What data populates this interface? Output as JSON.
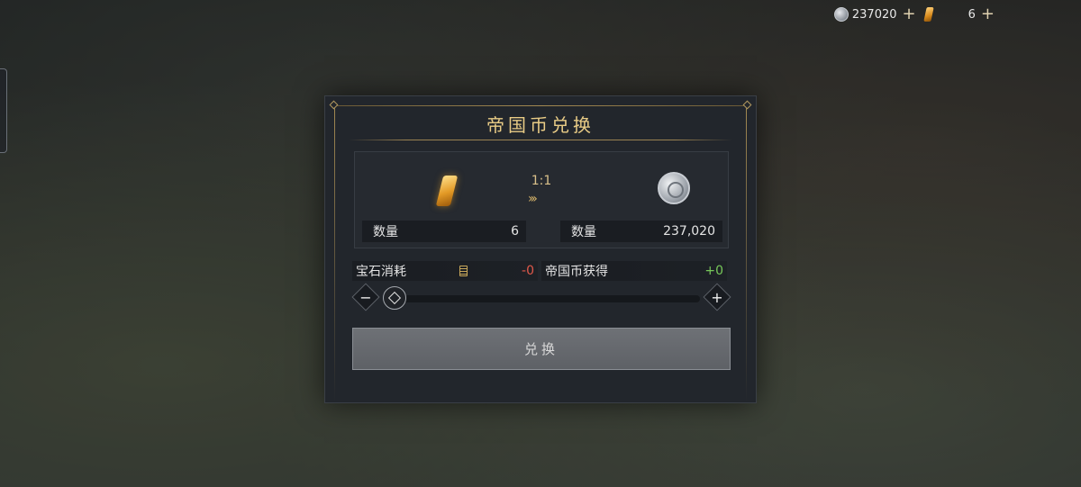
{
  "topbar": {
    "coin_amount": "237020",
    "coin_plus": "+",
    "gem_amount": "6",
    "gem_plus": "+"
  },
  "dialog": {
    "title": "帝国币兑换",
    "ratio": "1:1",
    "arrows": "›››",
    "left": {
      "qty_label": "数量",
      "qty_value": "6"
    },
    "right": {
      "qty_label": "数量",
      "qty_value": "237,020"
    },
    "cost": {
      "label": "宝石消耗",
      "value": "-0"
    },
    "gain": {
      "label": "帝国币获得",
      "value": "+0"
    },
    "slider": {
      "minus": "−",
      "plus": "+",
      "level": 0
    },
    "exchange_button": "兑换"
  },
  "colors": {
    "accent_gold": "#e9cc86",
    "negative": "#e0584a",
    "positive": "#77c85a"
  },
  "icons": [
    "coin-icon",
    "gem-icon",
    "calculator-icon",
    "slider-handle-icon",
    "minus-icon",
    "plus-icon"
  ]
}
